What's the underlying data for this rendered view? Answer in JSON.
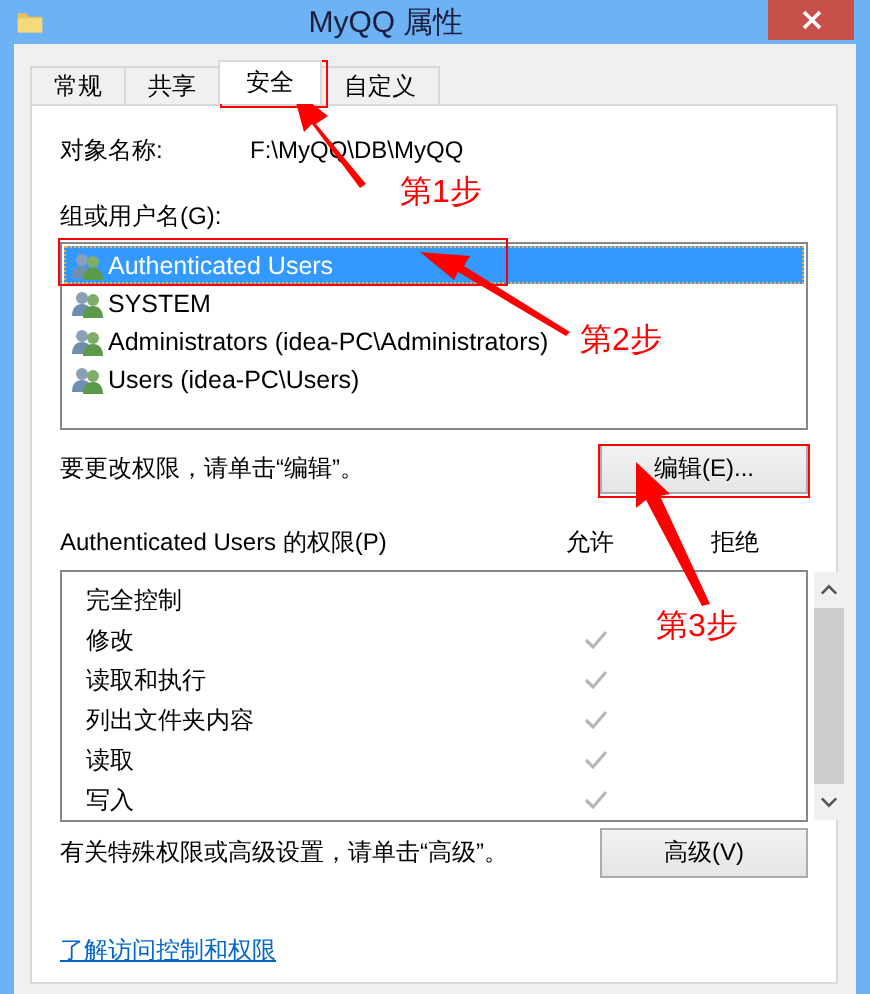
{
  "window": {
    "title": "MyQQ 属性"
  },
  "tabs": [
    {
      "label": "常规",
      "selected": false
    },
    {
      "label": "共享",
      "selected": false
    },
    {
      "label": "安全",
      "selected": true
    },
    {
      "label": "自定义",
      "selected": false
    }
  ],
  "object_name": {
    "label": "对象名称:",
    "value": "F:\\MyQQ\\DB\\MyQQ"
  },
  "groups_label": "组或用户名(G):",
  "groups": [
    {
      "name": "Authenticated Users",
      "selected": true
    },
    {
      "name": "SYSTEM",
      "selected": false
    },
    {
      "name": "Administrators (idea-PC\\Administrators)",
      "selected": false
    },
    {
      "name": "Users (idea-PC\\Users)",
      "selected": false
    }
  ],
  "change_hint": "要更改权限，请单击“编辑”。",
  "edit_button": "编辑(E)...",
  "permissions_label": "Authenticated Users 的权限(P)",
  "allow_header": "允许",
  "deny_header": "拒绝",
  "permissions": [
    {
      "name": "完全控制",
      "allow": false,
      "deny": false
    },
    {
      "name": "修改",
      "allow": true,
      "deny": false
    },
    {
      "name": "读取和执行",
      "allow": true,
      "deny": false
    },
    {
      "name": "列出文件夹内容",
      "allow": true,
      "deny": false
    },
    {
      "name": "读取",
      "allow": true,
      "deny": false
    },
    {
      "name": "写入",
      "allow": true,
      "deny": false
    }
  ],
  "advanced_hint": "有关特殊权限或高级设置，请单击“高级”。",
  "advanced_button": "高级(V)",
  "help_link": "了解访问控制和权限",
  "annotations": [
    {
      "text": "第1步"
    },
    {
      "text": "第2步"
    },
    {
      "text": "第3步"
    }
  ]
}
